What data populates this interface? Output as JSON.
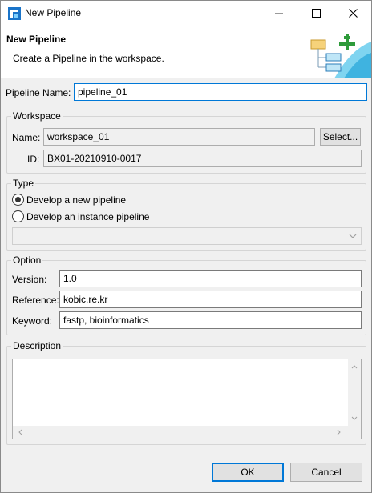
{
  "window": {
    "title": "New Pipeline",
    "minimize_icon": "minimize-icon",
    "maximize_icon": "maximize-icon",
    "close_icon": "close-icon"
  },
  "banner": {
    "title": "New Pipeline",
    "description": "Create a Pipeline in the workspace.",
    "art_icon": "new-pipeline-wizard-icon"
  },
  "pipeline_name": {
    "label": "Pipeline Name:",
    "value": "pipeline_01"
  },
  "workspace": {
    "group_title": "Workspace",
    "name_label": "Name:",
    "name_value": "workspace_01",
    "select_button": "Select...",
    "id_label": "ID:",
    "id_value": "BX01-20210910-0017"
  },
  "type": {
    "group_title": "Type",
    "options": [
      {
        "label": "Develop a new pipeline",
        "selected": true
      },
      {
        "label": "Develop an instance pipeline",
        "selected": false
      }
    ],
    "instance_combo_value": ""
  },
  "option": {
    "group_title": "Option",
    "version_label": "Version:",
    "version_value": "1.0",
    "reference_label": "Reference:",
    "reference_value": "kobic.re.kr",
    "keyword_label": "Keyword:",
    "keyword_value": "fastp, bioinformatics"
  },
  "description": {
    "group_title": "Description",
    "value": ""
  },
  "footer": {
    "ok_button": "OK",
    "cancel_button": "Cancel"
  },
  "colors": {
    "focus": "#0078d7",
    "accent_green": "#2e9b3a",
    "accent_blue": "#2b9bd6"
  }
}
